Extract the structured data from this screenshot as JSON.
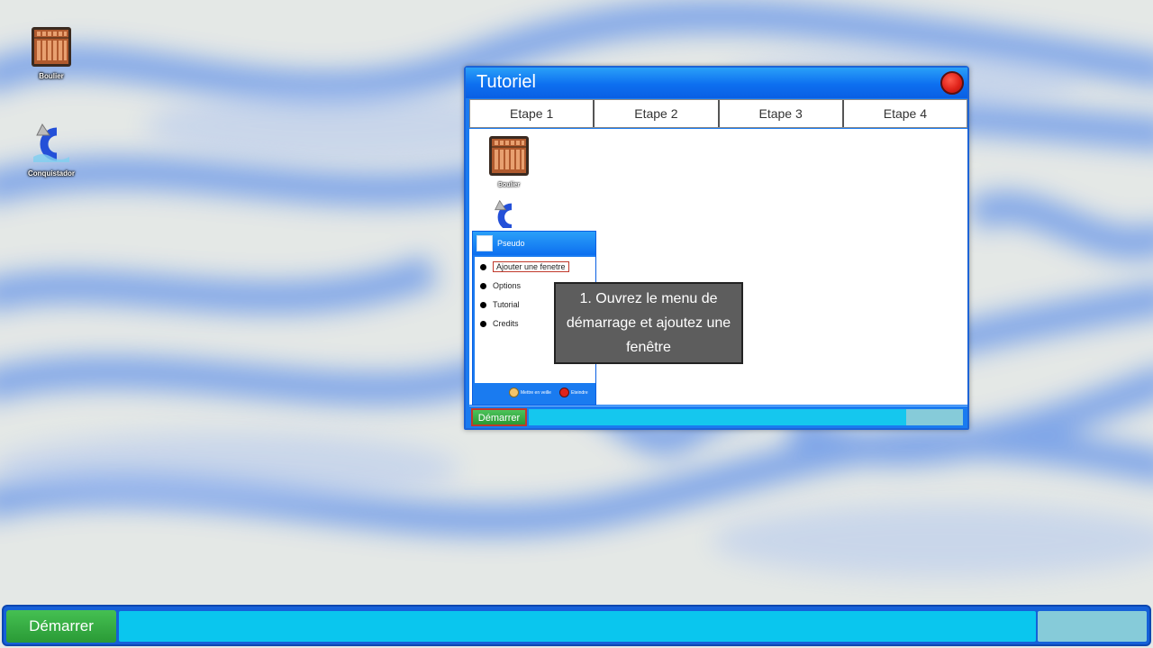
{
  "desktop": {
    "icons": [
      {
        "label": "Boulier",
        "icon": "abacus-icon"
      },
      {
        "label": "Conquistador",
        "icon": "shell-c-icon"
      }
    ]
  },
  "tutorial": {
    "title": "Tutoriel",
    "tabs": [
      "Etape 1",
      "Etape 2",
      "Etape 3",
      "Etape 4"
    ],
    "mini_desktop": {
      "icons": [
        {
          "label": "Boulier"
        }
      ]
    },
    "mini_menu": {
      "user": "Pseudo",
      "items": [
        "Ajouter une fenetre",
        "Options",
        "Tutorial",
        "Credits"
      ],
      "footer": {
        "sleep": "Mettre en veille",
        "shutdown": "Eteindre"
      }
    },
    "tooltip": [
      "1. Ouvrez le menu de",
      "démarrage et ajoutez une",
      "fenêtre"
    ],
    "start_label": "Démarrer"
  },
  "taskbar": {
    "start_label": "Démarrer"
  },
  "colors": {
    "window_blue": "#1a7bf0",
    "start_green": "#2a9a36",
    "taskbar_cyan": "#0ac6ee",
    "tray": "#86cbd9",
    "highlight_red": "#c0392b"
  }
}
